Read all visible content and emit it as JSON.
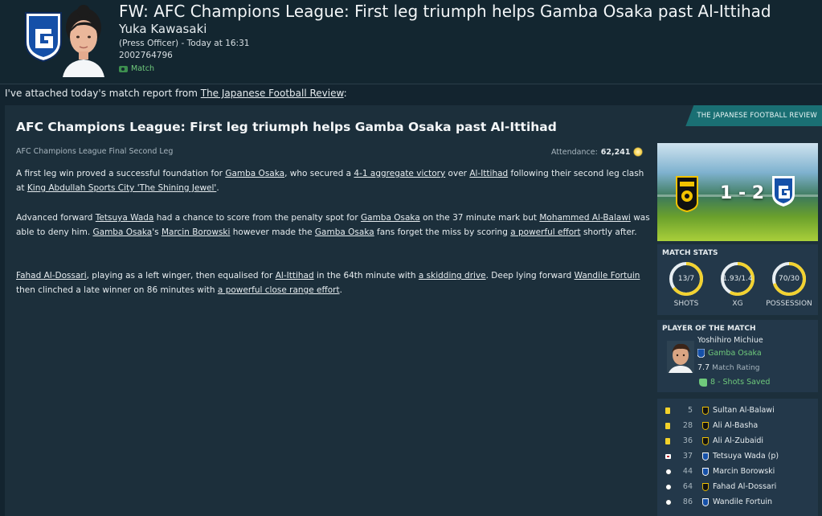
{
  "header": {
    "title": "FW: AFC Champions League: First leg triumph helps Gamba Osaka past Al-Ittihad",
    "sender_name": "Yuka Kawasaki",
    "sender_role": "(Press Officer) - Today at 16:31",
    "sender_id": "2002764796",
    "tag": "Match"
  },
  "intro": {
    "text": "I've attached today's match report from ",
    "source_link": "The Japanese Football Review",
    "suffix": ":"
  },
  "report": {
    "source_tag": "THE JAPANESE FOOTBALL REVIEW",
    "headline": "AFC Champions League: First leg triumph helps Gamba Osaka past Al-Ittihad",
    "competition": "AFC Champions League Final Second Leg",
    "attendance_label": "Attendance:",
    "attendance_value": "62,241",
    "p1": {
      "a": "A first leg win proved a successful foundation for ",
      "b": "Gamba Osaka",
      "c": ", who secured a ",
      "d": "4-1 aggregate victory",
      "e": " over ",
      "f": "Al-Ittihad",
      "g": " following their second leg clash at ",
      "h": "King Abdullah Sports City 'The Shining Jewel'",
      "i": "."
    },
    "p2": {
      "a": "Advanced forward ",
      "b": "Tetsuya Wada",
      "c": " had a chance to score from the penalty spot for ",
      "d": "Gamba Osaka",
      "e": " on the 37 minute mark but ",
      "f": "Mohammed Al-Balawi",
      "g": " was able to deny him. ",
      "h": "Gamba Osaka",
      "i": "'s ",
      "j": "Marcin Borowski",
      "k": " however made the ",
      "l": "Gamba Osaka",
      "m": " fans forget the miss by scoring ",
      "n": "a powerful effort",
      "o": " shortly after."
    },
    "p3": {
      "a": "Fahad Al-Dossari",
      "b": ", playing as a left winger, then equalised for ",
      "c": "Al-Ittihad",
      "d": " in the 64th minute with ",
      "e": "a skidding drive",
      "f": ". Deep lying forward ",
      "g": "Wandile Fortuin",
      "h": " then clinched a late winner on 86 minutes with ",
      "i": "a powerful close range effort",
      "j": "."
    }
  },
  "scoreboard": {
    "score": "1 - 2"
  },
  "match_stats": {
    "title": "MATCH STATS",
    "items": [
      {
        "label": "SHOTS",
        "value": "13/7",
        "home_share": 0.65
      },
      {
        "label": "XG",
        "value": "1.93/1.4",
        "home_share": 0.58
      },
      {
        "label": "POSSESSION",
        "value": "70/30",
        "home_share": 0.7
      }
    ]
  },
  "potm": {
    "title": "PLAYER OF THE MATCH",
    "name": "Yoshihiro Michiue",
    "club": "Gamba Osaka",
    "rating": "7.7",
    "rating_label": "Match Rating",
    "note": "8 - Shots Saved"
  },
  "events": [
    {
      "type": "yellow-card",
      "minute": "5",
      "team": "home",
      "player": "Sultan Al-Balawi"
    },
    {
      "type": "yellow-card",
      "minute": "28",
      "team": "home",
      "player": "Ali Al-Basha"
    },
    {
      "type": "yellow-card",
      "minute": "36",
      "team": "home",
      "player": "Ali Al-Zubaidi"
    },
    {
      "type": "penalty-missed",
      "minute": "37",
      "team": "away",
      "player": "Tetsuya Wada (p)"
    },
    {
      "type": "goal",
      "minute": "44",
      "team": "away",
      "player": "Marcin Borowski"
    },
    {
      "type": "goal",
      "minute": "64",
      "team": "home",
      "player": "Fahad Al-Dossari"
    },
    {
      "type": "goal",
      "minute": "86",
      "team": "away",
      "player": "Wandile Fortuin"
    }
  ],
  "colors": {
    "background": "#13242f",
    "card": "#1c2f3b",
    "panel": "#23384a",
    "accent_teal": "#1a6f73",
    "positive_green": "#6fc97b",
    "ring_yellow": "#f2d230",
    "ring_white": "#e8eef2",
    "yellow_card": "#f3d22a",
    "gamba_blue": "#1550a8",
    "ittihad_gold": "#f2c200"
  }
}
